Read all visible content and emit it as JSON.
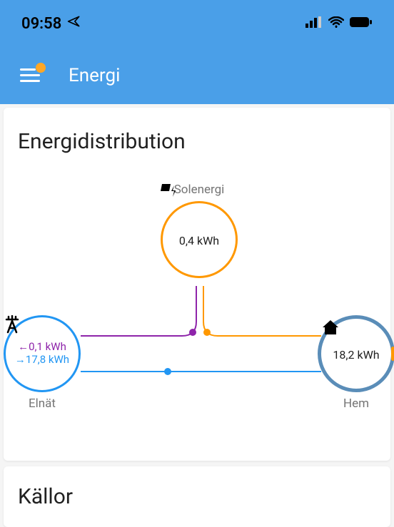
{
  "status": {
    "time": "09:58",
    "location_icon": "location",
    "signal": "signal",
    "wifi": "wifi",
    "battery": "battery"
  },
  "header": {
    "title": "Energi",
    "menu_has_badge": true
  },
  "distribution": {
    "title": "Energidistribution",
    "solar": {
      "label": "Solenergi",
      "value": "0,4 kWh",
      "color": "#ff9800"
    },
    "grid": {
      "label": "Elnät",
      "export_value": "←0,1 kWh",
      "import_value": "→17,8 kWh",
      "color": "#2196f3"
    },
    "home": {
      "label": "Hem",
      "value": "18,2 kWh",
      "color": "#5a8db8"
    }
  },
  "sources": {
    "title": "Källor"
  }
}
